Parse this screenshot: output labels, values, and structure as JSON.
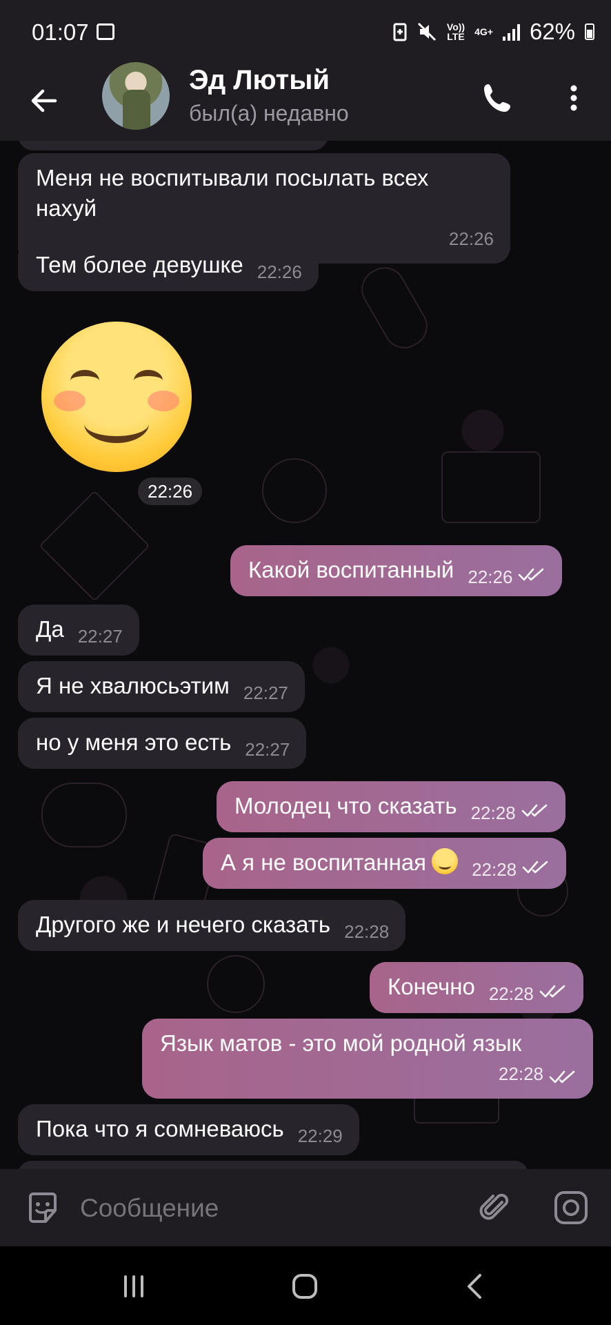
{
  "status_bar": {
    "time": "01:07",
    "network_label": "Vo))\nLTE",
    "network_type": "4G+",
    "battery": "62%",
    "icons": [
      "image-icon",
      "battery-saver-icon",
      "mute-icon",
      "volte-icon",
      "4g-icon",
      "signal-icon",
      "battery-icon"
    ]
  },
  "header": {
    "name": "Эд Лютый",
    "status": "был(а) недавно",
    "icons": [
      "back-arrow-icon",
      "phone-icon",
      "more-vert-icon"
    ]
  },
  "messages": [
    {
      "dir": "in",
      "text": "Меня не воспитывали посылать всех нахуй",
      "time": "22:26"
    },
    {
      "dir": "in",
      "text": "Тем более девушке",
      "time": "22:26"
    },
    {
      "dir": "in",
      "sticker": "smiling-face-emoji",
      "time": "22:26"
    },
    {
      "dir": "out",
      "text": "Какой воспитанный",
      "time": "22:26",
      "read": true
    },
    {
      "dir": "in",
      "text": "Да",
      "time": "22:27"
    },
    {
      "dir": "in",
      "text": "Я не хвалюсьэтим",
      "time": "22:27"
    },
    {
      "dir": "in",
      "text": "но у меня это есть",
      "time": "22:27"
    },
    {
      "dir": "out",
      "text": "Молодец что сказать",
      "time": "22:28",
      "read": true
    },
    {
      "dir": "out",
      "text": "А я не воспитанная",
      "emoji": "smiling-face-emoji",
      "time": "22:28",
      "read": true
    },
    {
      "dir": "in",
      "text": "Другого же и нечего сказать",
      "time": "22:28"
    },
    {
      "dir": "out",
      "text": "Конечно",
      "time": "22:28",
      "read": true
    },
    {
      "dir": "out",
      "text": "Язык матов - это мой родной язык",
      "time": "22:28",
      "read": true
    },
    {
      "dir": "in",
      "text": "Пока что я сомневаюсь",
      "time": "22:29"
    }
  ],
  "input": {
    "placeholder": "Сообщение",
    "icons": [
      "emoji-sticker-icon",
      "paperclip-icon",
      "camera-icon"
    ]
  },
  "nav": {
    "icons": [
      "recent-apps-icon",
      "home-icon",
      "back-icon"
    ]
  },
  "colors": {
    "bg": "#0b0a0d",
    "bar": "#1f1d22",
    "incoming": "#27252b",
    "outgoing_start": "#a8648a",
    "outgoing_end": "#9a6f9e"
  }
}
